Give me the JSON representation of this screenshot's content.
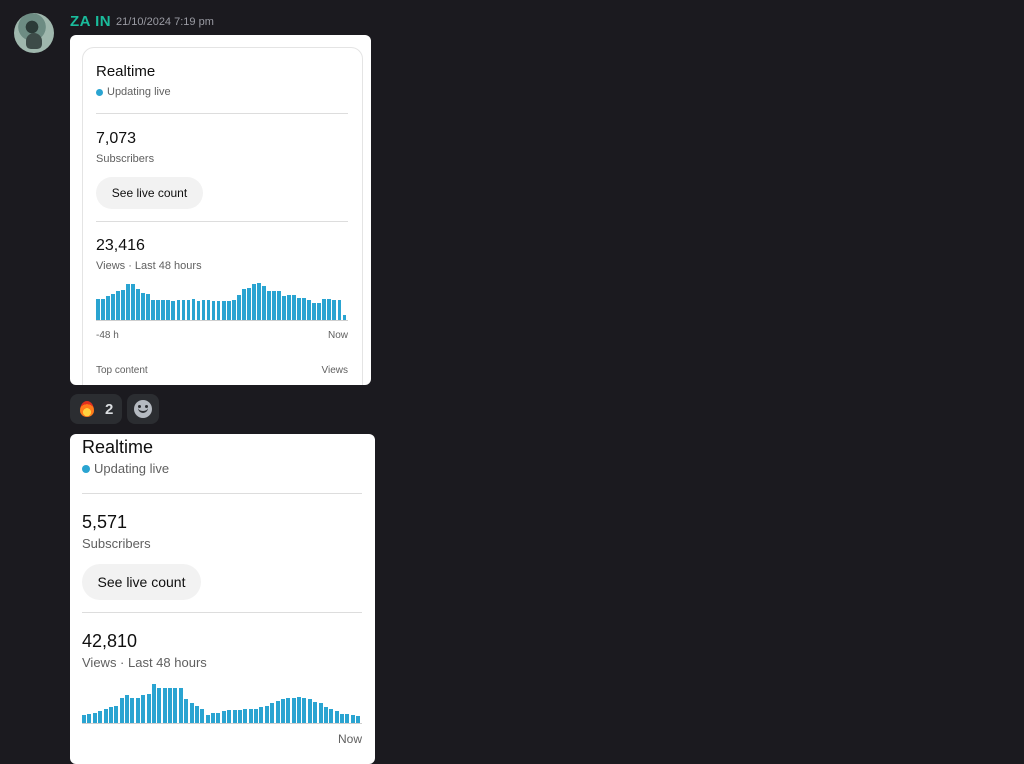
{
  "message": {
    "author": "ZA IN",
    "timestamp": "21/10/2024 7:19 pm"
  },
  "card1": {
    "title": "Realtime",
    "live_label": "Updating live",
    "subscribers_value": "7,073",
    "subscribers_label": "Subscribers",
    "button_label": "See live count",
    "views_value": "23,416",
    "views_label": "Views · Last 48 hours",
    "axis_start": "-48 h",
    "axis_end": "Now",
    "footer_left": "Top content",
    "footer_right": "Views"
  },
  "reactions": {
    "fire_count": "2"
  },
  "card2": {
    "title": "Realtime",
    "live_label": "Updating live",
    "subscribers_value": "5,571",
    "subscribers_label": "Subscribers",
    "button_label": "See live count",
    "views_value": "42,810",
    "views_label": "Views · Last 48 hours",
    "axis_end": "Now"
  },
  "chart_data": [
    {
      "type": "bar",
      "series": [
        {
          "values": [
            17,
            17,
            19,
            21,
            23,
            24,
            29,
            29,
            25,
            22,
            21,
            16,
            16,
            16,
            16,
            15,
            16,
            16,
            16,
            17,
            15,
            16,
            16,
            15,
            15,
            15,
            15,
            16,
            20,
            25,
            26,
            29,
            30,
            27,
            23,
            23,
            23,
            19,
            20,
            20,
            18,
            18,
            16,
            14,
            14,
            17,
            17,
            16,
            16,
            4
          ]
        }
      ],
      "xlabels": [
        "-48 h",
        "Now"
      ]
    },
    {
      "type": "bar",
      "series": [
        {
          "values": [
            6,
            7,
            8,
            9,
            11,
            12,
            13,
            19,
            21,
            19,
            19,
            21,
            22,
            30,
            27,
            27,
            27,
            27,
            27,
            18,
            15,
            13,
            11,
            6,
            8,
            8,
            9,
            10,
            10,
            10,
            11,
            11,
            11,
            12,
            13,
            15,
            17,
            18,
            19,
            19,
            20,
            19,
            18,
            16,
            15,
            12,
            11,
            9,
            7,
            7,
            6,
            5
          ]
        }
      ],
      "xlabels": [
        "Now"
      ]
    }
  ]
}
